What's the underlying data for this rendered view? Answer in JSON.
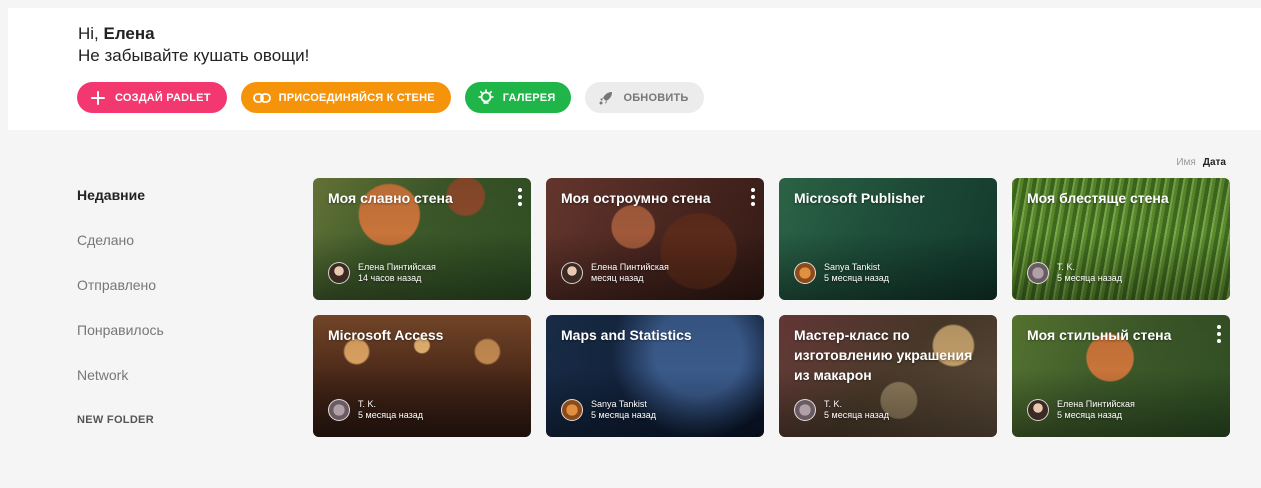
{
  "header": {
    "greeting_prefix": "Hi, ",
    "user_name": "Елена",
    "tagline": "Не забывайте кушать овощи!",
    "buttons": {
      "create": "СОЗДАЙ PADLET",
      "join": "ПРИСОЕДИНЯЙСЯ К СТЕНЕ",
      "gallery": "ГАЛЕРЕЯ",
      "update": "ОБНОВИТЬ"
    }
  },
  "sort": {
    "name": "Имя",
    "date": "Дата",
    "active": "Дата"
  },
  "sidebar": {
    "items": [
      {
        "label": "Недавние",
        "active": true
      },
      {
        "label": "Сделано"
      },
      {
        "label": "Отправлено"
      },
      {
        "label": "Понравилось"
      },
      {
        "label": "Network"
      }
    ],
    "new_folder": "NEW FOLDER"
  },
  "cards": [
    {
      "title": "Моя славно стена",
      "author": "Елена Пинтийская",
      "time": "14 часов назад",
      "menu": true,
      "background": "tulip",
      "avatar": "female-photo"
    },
    {
      "title": "Моя остроумно стена",
      "author": "Елена Пинтийская",
      "time": "месяц назад",
      "menu": true,
      "background": "dessert",
      "avatar": "female-photo"
    },
    {
      "title": "Microsoft Publisher",
      "author": "Sanya Tankist",
      "time": "5 месяца назад",
      "menu": false,
      "background": "forest",
      "avatar": "tiger"
    },
    {
      "title": "Моя блестяще стена",
      "author": "T. K.",
      "time": "5 месяца назад",
      "menu": false,
      "background": "grass",
      "avatar": "tk"
    },
    {
      "title": "Microsoft Access",
      "author": "T. K.",
      "time": "5 месяца назад",
      "menu": false,
      "background": "beads",
      "avatar": "tk"
    },
    {
      "title": "Maps and Statistics",
      "author": "Sanya Tankist",
      "time": "5 месяца назад",
      "menu": false,
      "background": "space",
      "avatar": "tiger"
    },
    {
      "title": "Мастер-класс по изготовлению украшения из макарон",
      "author": "T. K.",
      "time": "5 месяца назад",
      "menu": false,
      "background": "bokeh",
      "avatar": "tk"
    },
    {
      "title": "Моя стильный стена",
      "author": "Елена Пинтийская",
      "time": "5 месяца назад",
      "menu": true,
      "background": "tulip",
      "avatar": "female-photo"
    }
  ],
  "colors": {
    "create": "#f2386f",
    "join": "#f5930b",
    "gallery": "#1fb548",
    "update_bg": "#ececec"
  }
}
